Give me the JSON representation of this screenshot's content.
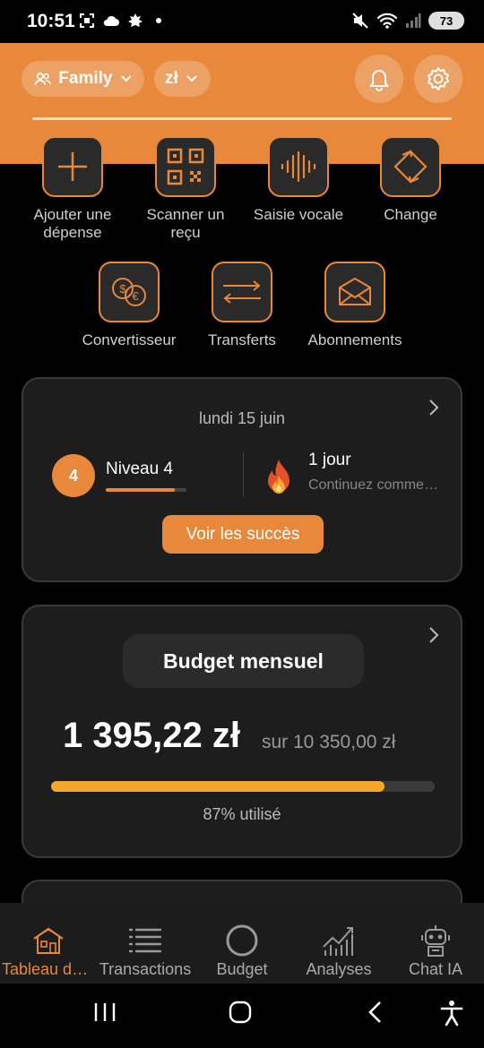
{
  "status_bar": {
    "time": "10:51",
    "battery": "73"
  },
  "header": {
    "family_label": "Family",
    "currency_label": "zł"
  },
  "quick_actions": [
    {
      "label": "Ajouter une dépense",
      "icon": "plus-icon"
    },
    {
      "label": "Scanner un reçu",
      "icon": "qr-code-icon"
    },
    {
      "label": "Saisie vocale",
      "icon": "voice-wave-icon"
    },
    {
      "label": "Change",
      "icon": "exchange-icon"
    },
    {
      "label": "Convertisseur",
      "icon": "currency-convert-icon"
    },
    {
      "label": "Transferts",
      "icon": "transfer-arrows-icon"
    },
    {
      "label": "Abonnements",
      "icon": "envelope-icon"
    }
  ],
  "progress_card": {
    "date": "lundi 15 juin",
    "level_number": "4",
    "level_label": "Niveau 4",
    "level_progress": 0.85,
    "streak_title": "1 jour",
    "streak_subtitle": "Continuez comme ça",
    "achievements_button": "Voir les succès"
  },
  "budget_card": {
    "title": "Budget mensuel",
    "spent": "1 395,22 zł",
    "total": "sur 10 350,00 zł",
    "used_fraction": 0.87,
    "used_label": "87% utilisé"
  },
  "bottom_nav": [
    {
      "label": "Tableau de bord",
      "icon": "house-icon",
      "active": true
    },
    {
      "label": "Transactions",
      "icon": "list-icon",
      "active": false
    },
    {
      "label": "Budget",
      "icon": "ring-icon",
      "active": false
    },
    {
      "label": "Analyses",
      "icon": "chart-icon",
      "active": false
    },
    {
      "label": "Chat IA",
      "icon": "robot-icon",
      "active": false
    }
  ],
  "colors": {
    "accent": "#e8883a",
    "bar": "#f4a82a",
    "card": "#1d1d1d"
  }
}
